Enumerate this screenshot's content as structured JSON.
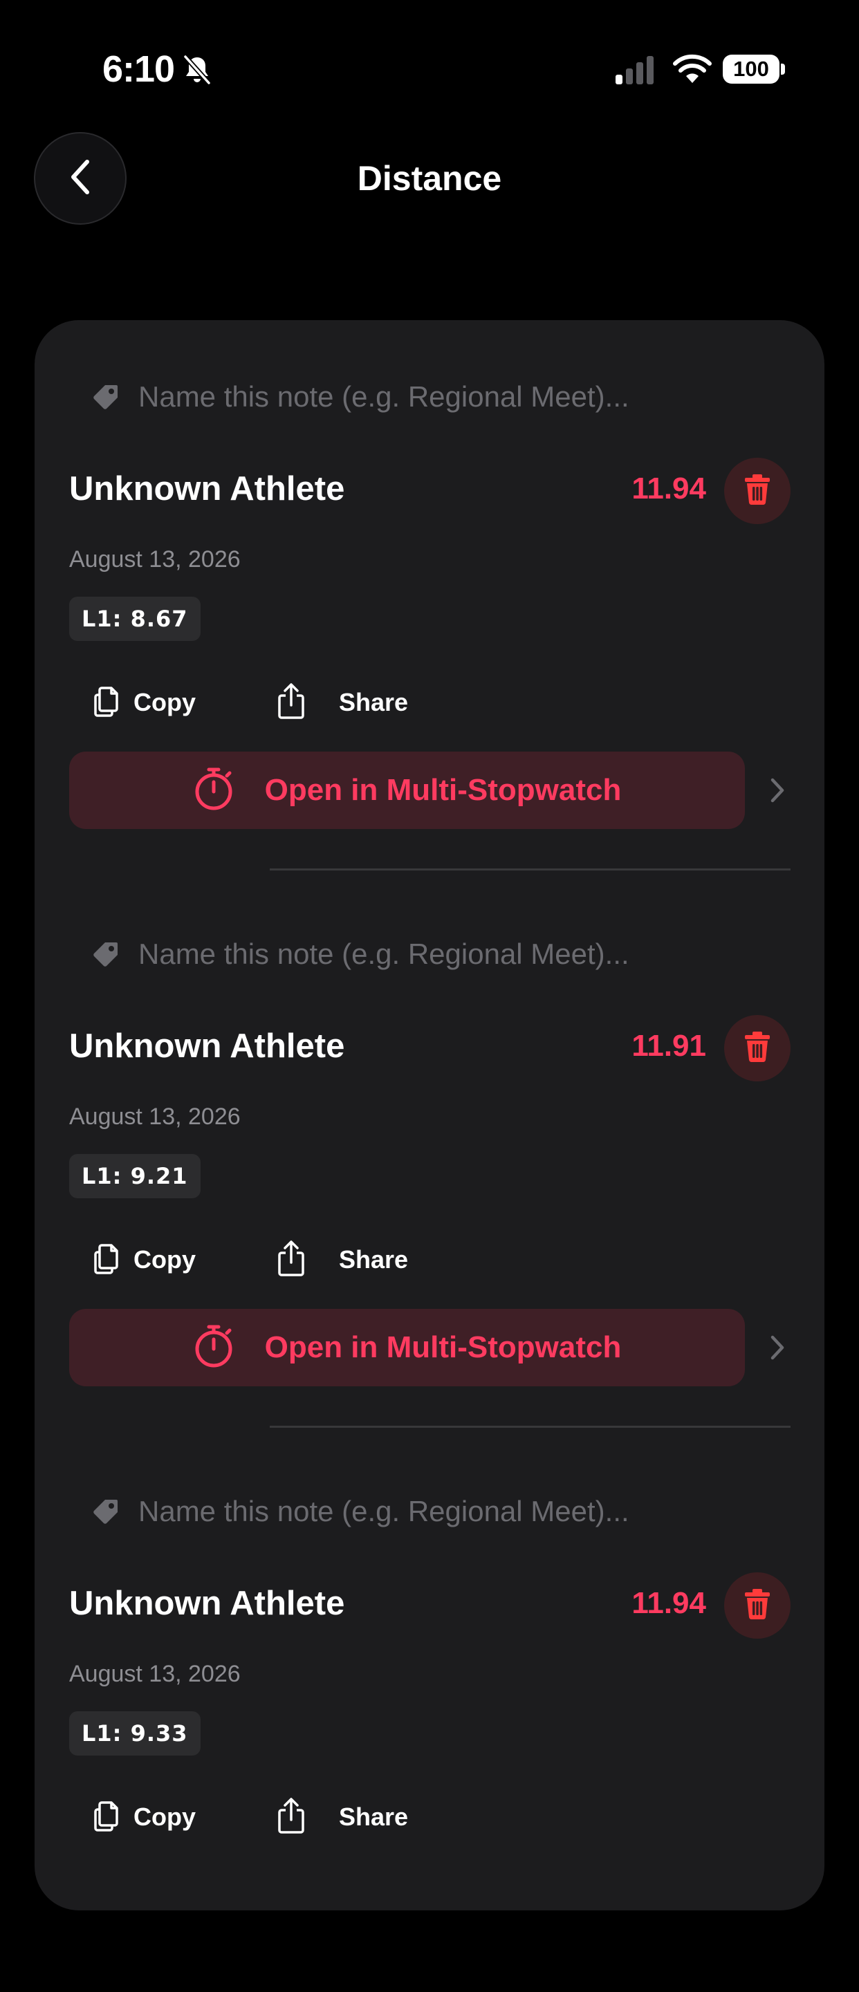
{
  "status_bar": {
    "time": "6:10",
    "battery": "100",
    "colors": {
      "foreground": "#ffffff"
    },
    "icons": [
      "bell-off-icon",
      "signal-icon",
      "wifi-icon",
      "battery-icon"
    ]
  },
  "nav": {
    "title": "Distance",
    "back_icon": "chevron-left-icon"
  },
  "entries": [
    {
      "note_placeholder": "Name this note (e.g. Regional Meet)...",
      "athlete": "Unknown Athlete",
      "time": "11.94",
      "date": "August 13, 2026",
      "lap": "L1: 8.67",
      "copy_label": "Copy",
      "share_label": "Share",
      "stopwatch_label": "Open in Multi-Stopwatch"
    },
    {
      "note_placeholder": "Name this note (e.g. Regional Meet)...",
      "athlete": "Unknown Athlete",
      "time": "11.91",
      "date": "August 13, 2026",
      "lap": "L1: 9.21",
      "copy_label": "Copy",
      "share_label": "Share",
      "stopwatch_label": "Open in Multi-Stopwatch"
    },
    {
      "note_placeholder": "Name this note (e.g. Regional Meet)...",
      "athlete": "Unknown Athlete",
      "time": "11.94",
      "date": "August 13, 2026",
      "lap": "L1: 9.33",
      "copy_label": "Copy",
      "share_label": "Share",
      "stopwatch_label": "Open in Multi-Stopwatch"
    }
  ],
  "colors": {
    "background": "#000000",
    "card": "#1c1c1e",
    "accent": "#ff3b60",
    "delete_bg": "#3c1e21",
    "stopwatch_bg": "#3f1f26",
    "secondary_text": "#8e8e93",
    "placeholder_text": "#6b6b70"
  }
}
